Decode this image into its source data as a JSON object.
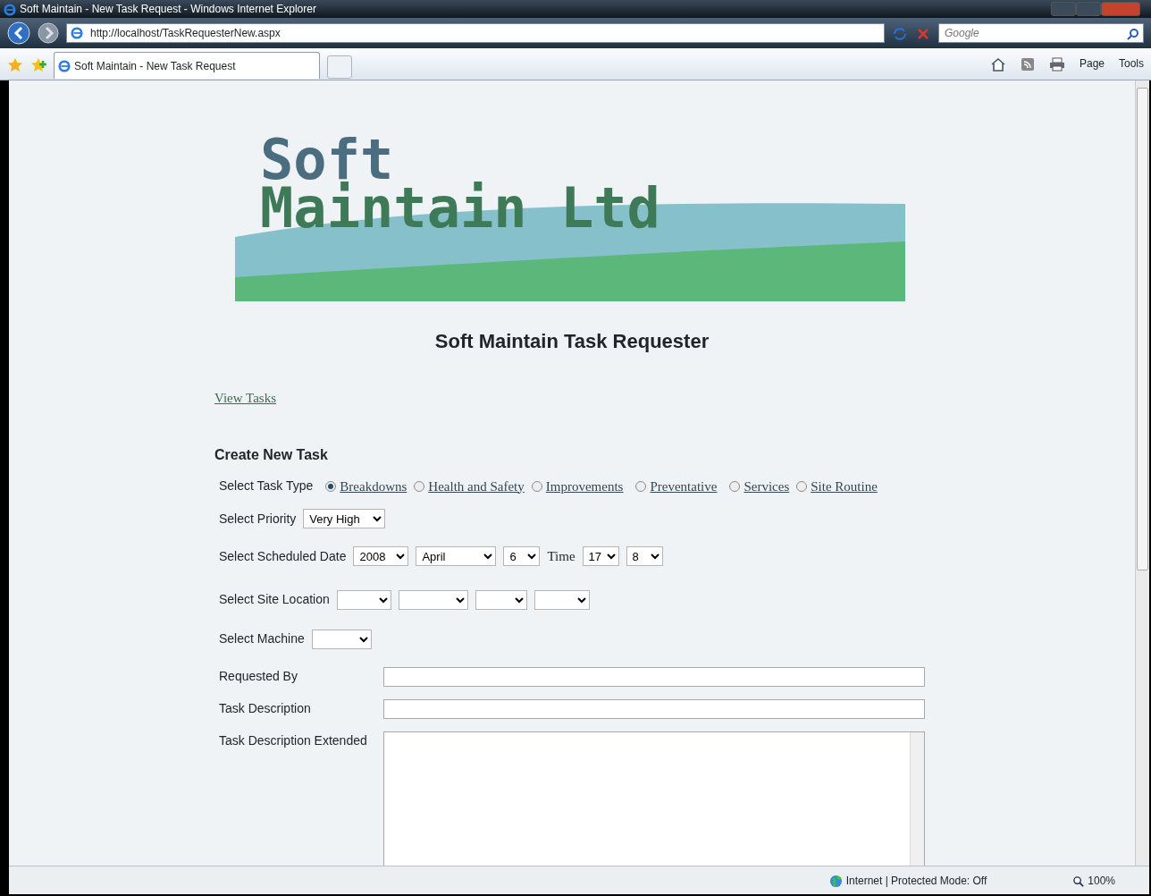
{
  "window": {
    "title": "Soft Maintain - New Task Request - Windows Internet Explorer"
  },
  "address_bar": {
    "url": "http://localhost/TaskRequesterNew.aspx"
  },
  "search": {
    "placeholder": "Google"
  },
  "tabs": [
    {
      "label": "Soft Maintain - New Task Request",
      "selected": true
    }
  ],
  "command_bar": {
    "page": "Page",
    "tools": "Tools"
  },
  "logo": {
    "line_1": "Soft",
    "line_2": "Maintain Ltd"
  },
  "heading": "Soft Maintain Task Requester",
  "view_tasks_link": "View Tasks",
  "form": {
    "title": "Create New Task",
    "task_type": {
      "label": "Select Task Type",
      "options": [
        {
          "label": "Breakdowns",
          "selected": true
        },
        {
          "label": "Health and Safety",
          "selected": false
        },
        {
          "label": "Improvements",
          "selected": false
        },
        {
          "label": "Preventative",
          "selected": false
        },
        {
          "label": "Services",
          "selected": false
        },
        {
          "label": "Site Routine",
          "selected": false
        }
      ]
    },
    "priority": {
      "label": "Select Priority",
      "value": "Very High"
    },
    "scheduled_date": {
      "label": "Select Scheduled Date",
      "year": "2008",
      "month": "April",
      "day": "6",
      "time_label": "Time",
      "hour": "17",
      "minute": "8"
    },
    "site_location": {
      "label": "Select Site Location"
    },
    "machine": {
      "label": "Select Machine"
    },
    "requested_by": {
      "label": "Requested By"
    },
    "task_description": {
      "label": "Task Description"
    },
    "task_description_extended": {
      "label": "Task Description Extended"
    }
  },
  "status_bar": {
    "zone": "Internet | Protected Mode: Off",
    "zoom": "100%"
  }
}
